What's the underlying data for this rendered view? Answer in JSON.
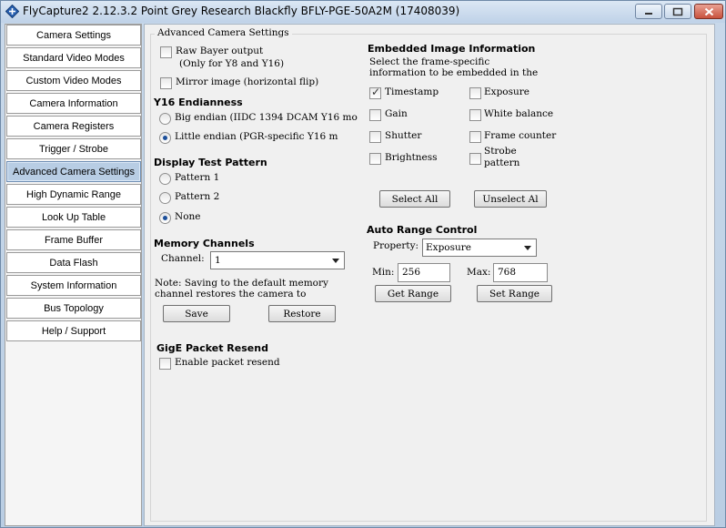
{
  "window": {
    "title": "FlyCapture2 2.12.3.2  Point Grey Research Blackfly BFLY-PGE-50A2M (17408039)"
  },
  "sidebar": {
    "items": [
      {
        "label": "Camera Settings"
      },
      {
        "label": "Standard Video Modes"
      },
      {
        "label": "Custom Video Modes"
      },
      {
        "label": "Camera Information"
      },
      {
        "label": "Camera Registers"
      },
      {
        "label": "Trigger / Strobe"
      },
      {
        "label": "Advanced Camera Settings",
        "active": true
      },
      {
        "label": "High Dynamic Range"
      },
      {
        "label": "Look Up Table"
      },
      {
        "label": "Frame Buffer"
      },
      {
        "label": "Data Flash"
      },
      {
        "label": "System Information"
      },
      {
        "label": "Bus Topology"
      },
      {
        "label": "Help / Support"
      }
    ]
  },
  "advanced": {
    "group_title": "Advanced Camera Settings",
    "raw_bayer": {
      "label_line1": "Raw Bayer output",
      "label_line2": "(Only for Y8 and Y16)",
      "checked": false
    },
    "mirror": {
      "label": "Mirror image (horizontal flip)",
      "checked": false
    },
    "endianness": {
      "heading": "Y16 Endianness",
      "big": {
        "label": "Big endian (IIDC 1394 DCAM Y16 mo",
        "selected": false
      },
      "little": {
        "label": "Little endian (PGR-specific Y16 m",
        "selected": true
      }
    },
    "test_pattern": {
      "heading": "Display Test Pattern",
      "options": [
        {
          "label": "Pattern 1",
          "selected": false
        },
        {
          "label": "Pattern 2",
          "selected": false
        },
        {
          "label": "None",
          "selected": true
        }
      ]
    },
    "memory": {
      "heading": "Memory Channels",
      "channel_label": "Channel:",
      "channel_value": "1",
      "note_line1": "Note: Saving to the default memory",
      "note_line2": "channel restores the camera to",
      "save_label": "Save",
      "restore_label": "Restore"
    },
    "gige": {
      "heading": "GigE Packet Resend",
      "enable_label": "Enable packet resend",
      "checked": false
    },
    "embedded": {
      "heading": "Embedded Image Information",
      "desc_line1": "Select the frame-specific",
      "desc_line2": "information to be embedded in the",
      "items": [
        {
          "label": "Timestamp",
          "checked": true
        },
        {
          "label": "Exposure",
          "checked": false
        },
        {
          "label": "Gain",
          "checked": false
        },
        {
          "label": "White balance",
          "checked": false
        },
        {
          "label": "Shutter",
          "checked": false
        },
        {
          "label": "Frame counter",
          "checked": false
        },
        {
          "label": "Brightness",
          "checked": false
        },
        {
          "label": "Strobe pattern",
          "checked": false
        }
      ],
      "strobe_line1": "Strobe",
      "strobe_line2": "pattern",
      "select_all_label": "Select All",
      "unselect_all_label": "Unselect Al"
    },
    "auto_range": {
      "heading": "Auto Range Control",
      "property_label": "Property:",
      "property_value": "Exposure",
      "min_label": "Min:",
      "min_value": "256",
      "max_label": "Max:",
      "max_value": "768",
      "get_label": "Get Range",
      "set_label": "Set Range"
    }
  }
}
